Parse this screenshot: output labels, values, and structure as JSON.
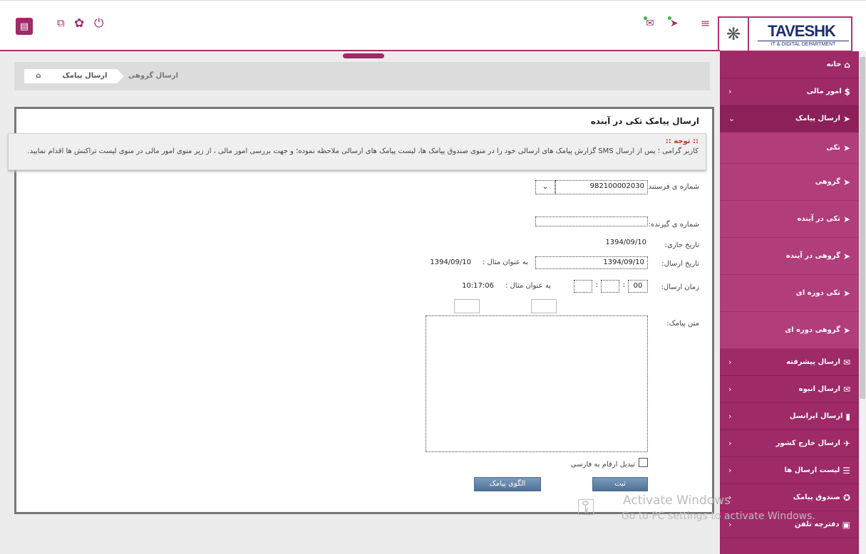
{
  "header": {
    "left_icons": [
      "grid-icon",
      "copy-icon",
      "gear-icon",
      "power-icon"
    ],
    "right_icons": [
      "mail-icon",
      "send-icon",
      "menu-icon"
    ],
    "logo_brand": "TAVESHK",
    "logo_dept": "IT & DIGITAL DEPARTMENT",
    "accent": "#9e2a68"
  },
  "breadcrumb": {
    "home_icon": "home-icon",
    "item1": "ارسال پیامک",
    "item2": "ارسال گروهی"
  },
  "sidebar": {
    "items": [
      {
        "label": "خانه",
        "icon": "home-icon",
        "chevron": ""
      },
      {
        "label": "امور مالی",
        "icon": "dollar-icon",
        "chevron": "‹"
      },
      {
        "label": "ارسال پیامک",
        "icon": "send-icon",
        "chevron": "⌄"
      }
    ],
    "subitems": [
      {
        "label": "تکی",
        "icon": "send-icon"
      },
      {
        "label": "گروهی",
        "icon": "send-icon"
      },
      {
        "label": "تکی در آینده",
        "icon": "send-icon"
      },
      {
        "label": "گروهی در آینده",
        "icon": "send-icon"
      },
      {
        "label": "تکی دوره ای",
        "icon": "send-icon"
      },
      {
        "label": "گروهی دوره ای",
        "icon": "send-icon"
      }
    ],
    "bottom_items": [
      {
        "label": "ارسال پیشرفته",
        "icon": "mail-icon",
        "chevron": "‹"
      },
      {
        "label": "ارسال انبوه",
        "icon": "mail-icon",
        "chevron": "‹"
      },
      {
        "label": "ارسال ایرانسل",
        "icon": "sim-icon",
        "chevron": "‹"
      },
      {
        "label": "ارسال خارج کشور",
        "icon": "plane-icon",
        "chevron": "‹"
      },
      {
        "label": "لیست ارسال ها",
        "icon": "list-icon",
        "chevron": "‹"
      },
      {
        "label": "صندوق پیامک",
        "icon": "inbox-icon",
        "chevron": "‹"
      },
      {
        "label": "دفترچه تلفن",
        "icon": "book-icon",
        "chevron": "‹"
      }
    ]
  },
  "panel": {
    "title": "ارسال پیامک تکی در آینده",
    "notice_title": ":: توجه ::",
    "notice_text": "کاربر گرامی ؛ پس از ارسال SMS گزارش پیامک های ارسالی خود را در منوی صندوق پیامک ها، لیست پیامک های ارسالی ملاحظه نموده؛ و جهت بررسی امور مالی ، از زیر منوی امور مالی در منوی لیست تراکنش ها اقدام نمایید.",
    "sender_label": "شماره ی فرستنده:",
    "sender_value": "982100002030",
    "receiver_label": "شماره ی گیرنده:",
    "current_date_label": "تاریخ جاری:",
    "current_date_value": "1394/09/10",
    "send_date_label": "تاریخ ارسال:",
    "send_date_value": "1394/09/10",
    "send_date_example_label": "به عنوان مثال :",
    "send_date_example_value": "1394/09/10",
    "send_time_label": "زمان ارسال:",
    "send_time_hour": "00",
    "send_time_sep": ":",
    "send_time_example_label": "به عنوان مثال :",
    "send_time_example_value": "10:17:06",
    "message_label": "متن پیامک:",
    "convert_label": "تبدیل ارقام به فارسی",
    "submit_label": "ثبت",
    "template_label": "الگوی پیامک"
  },
  "watermark": {
    "line1": "Activate Windows",
    "line2": "Go to PC settings to activate Windows."
  }
}
